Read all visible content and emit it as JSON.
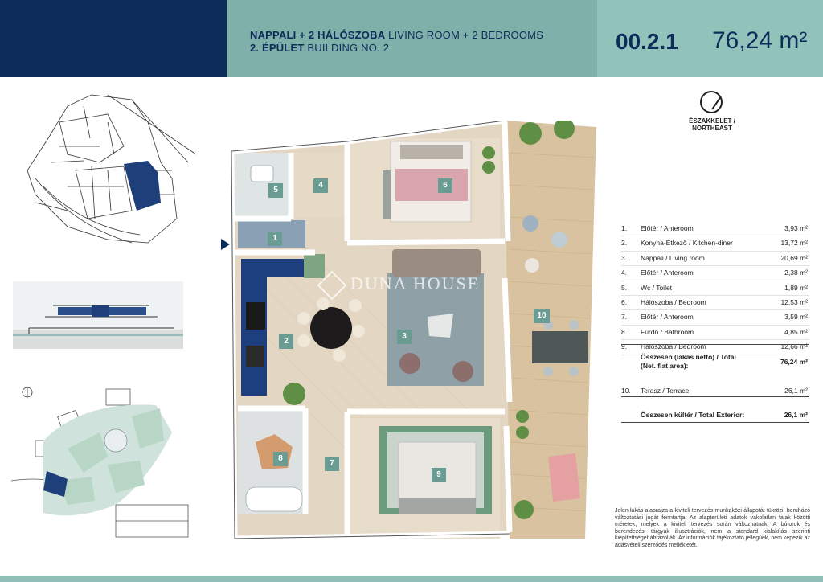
{
  "header": {
    "line1_bold": "NAPPALI + 2 HÁLÓSZOBA",
    "line1_light": "LIVING ROOM + 2 BEDROOMS",
    "line2_bold": "2. ÉPÜLET",
    "line2_light": "BUILDING NO. 2",
    "unit_code": "00.2.1",
    "unit_area": "76,24 m²"
  },
  "compass": {
    "label": "ÉSZAKKELET / NORTHEAST",
    "icon": "compass-icon"
  },
  "rooms": [
    {
      "num": "1.",
      "name": "Előtér / Anteroom",
      "area": "3,93 m²"
    },
    {
      "num": "2.",
      "name": "Konyha-Étkező / Kitchen-diner",
      "area": "13,72 m²"
    },
    {
      "num": "3.",
      "name": "Nappali / Living room",
      "area": "20,69 m²"
    },
    {
      "num": "4.",
      "name": "Előtér / Anteroom",
      "area": "2,38 m²"
    },
    {
      "num": "5.",
      "name": "Wc / Toilet",
      "area": "1,89 m²"
    },
    {
      "num": "6.",
      "name": "Hálószoba / Bedroom",
      "area": "12,53 m²"
    },
    {
      "num": "7.",
      "name": "Előtér / Anteroom",
      "area": "3,59 m²"
    },
    {
      "num": "8.",
      "name": "Fürdő / Bathroom",
      "area": "4,85 m²"
    },
    {
      "num": "9.",
      "name": "Hálószoba / Bedroom",
      "area": "12,66 m²"
    }
  ],
  "total_net": {
    "label": "Összesen (lakás nettó) / Total (Net. flat area):",
    "value": "76,24 m²"
  },
  "terrace": {
    "num": "10.",
    "name": "Terasz / Terrace",
    "area": "26,1 m²"
  },
  "total_exterior": {
    "label": "Összesen kültér / Total Exterior:",
    "value": "26,1 m²"
  },
  "disclaimer": "Jelen lakás alaprajza a kiviteli tervezés munkaközi állapotát tükrözi, beruházó változtatási jogát fenntartja. Az alapterületi adatok vakolatlan falak közötti méretek, melyek a kiviteli tervezés során változhatnak. A bútorok és berendezési tárgyak illusztrációk, nem a standard kialakítás szerinti kiépítettséget ábrázolják. Az információk tájékoztató jellegűek, nem képezik az adásvételi szerződés mellékletét.",
  "plan_labels": [
    "1",
    "2",
    "3",
    "4",
    "5",
    "6",
    "7",
    "8",
    "9",
    "10"
  ],
  "watermark": "DUNA HOUSE",
  "colors": {
    "navy": "#0c2d5a",
    "teal_mid": "#7fb0a9",
    "teal_light": "#92c3ba",
    "label_bg": "#6a9c94"
  }
}
